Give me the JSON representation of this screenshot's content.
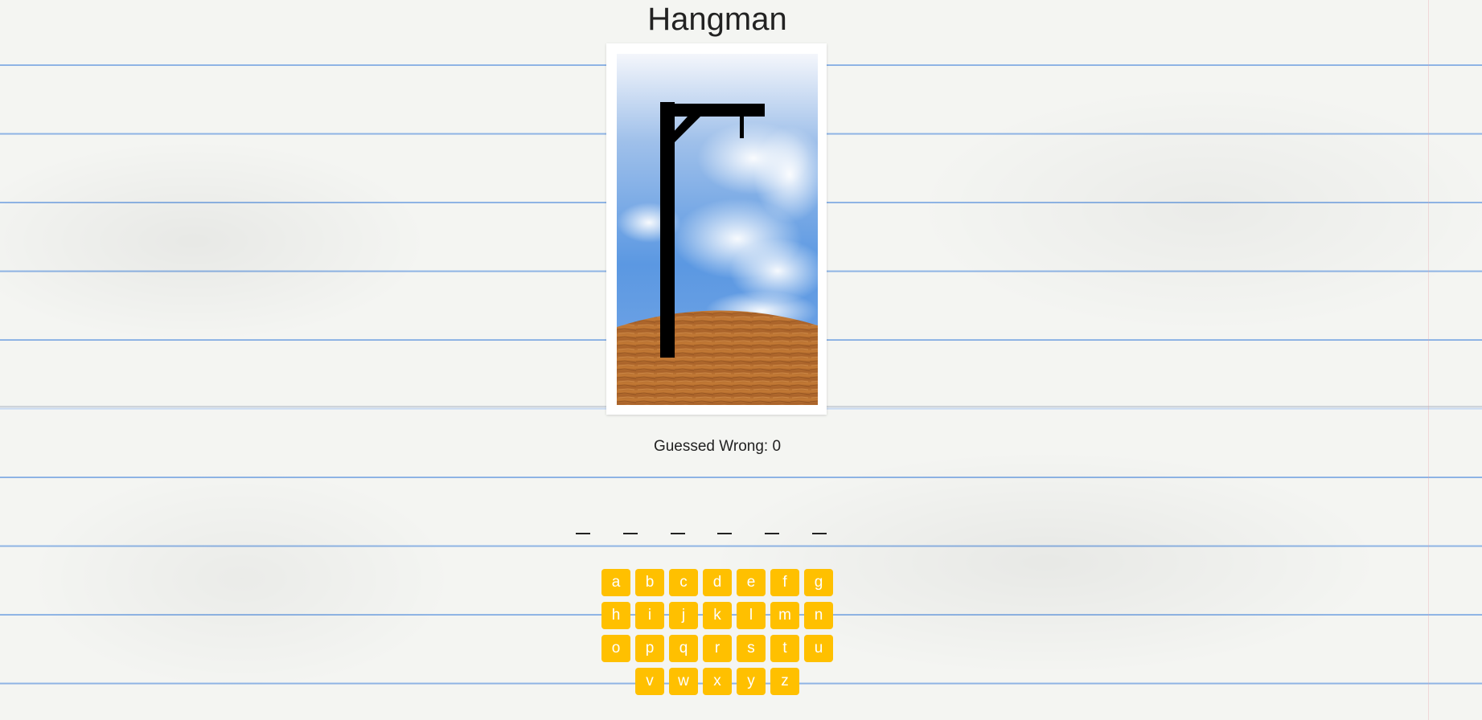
{
  "title": "Hangman",
  "status": {
    "wrong_label": "Guessed Wrong: 0",
    "wrong_count": 0
  },
  "word": {
    "letters": [
      "_",
      "_",
      "_",
      "_",
      "_",
      "_"
    ]
  },
  "keyboard": {
    "rows": [
      [
        "a",
        "b",
        "c",
        "d",
        "e",
        "f",
        "g"
      ],
      [
        "h",
        "i",
        "j",
        "k",
        "l",
        "m",
        "n"
      ],
      [
        "o",
        "p",
        "q",
        "r",
        "s",
        "t",
        "u"
      ],
      [
        "v",
        "w",
        "x",
        "y",
        "z"
      ]
    ]
  },
  "colors": {
    "key": "#ffc000",
    "key_text": "#ffffff",
    "sky_top": "#f2f5fb",
    "sky_bottom": "#4f8fe0",
    "ground": "#b36a2c",
    "gallows": "#000000"
  }
}
